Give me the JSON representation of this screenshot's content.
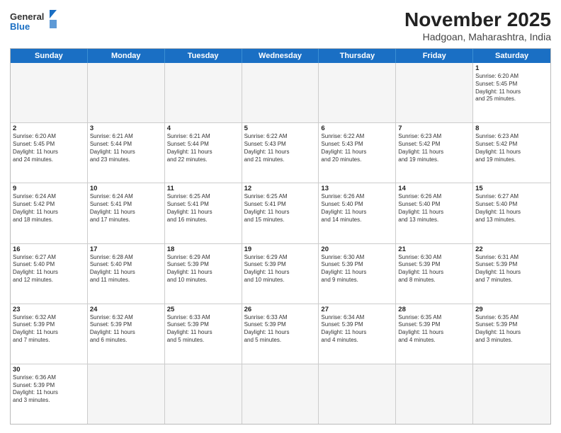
{
  "header": {
    "logo_line1": "General",
    "logo_line2": "Blue",
    "month": "November 2025",
    "location": "Hadgoan, Maharashtra, India"
  },
  "weekdays": [
    "Sunday",
    "Monday",
    "Tuesday",
    "Wednesday",
    "Thursday",
    "Friday",
    "Saturday"
  ],
  "rows": [
    [
      {
        "day": "",
        "info": "",
        "empty": true
      },
      {
        "day": "",
        "info": "",
        "empty": true
      },
      {
        "day": "",
        "info": "",
        "empty": true
      },
      {
        "day": "",
        "info": "",
        "empty": true
      },
      {
        "day": "",
        "info": "",
        "empty": true
      },
      {
        "day": "",
        "info": "",
        "empty": true
      },
      {
        "day": "1",
        "info": "Sunrise: 6:20 AM\nSunset: 5:45 PM\nDaylight: 11 hours\nand 25 minutes."
      }
    ],
    [
      {
        "day": "2",
        "info": "Sunrise: 6:20 AM\nSunset: 5:45 PM\nDaylight: 11 hours\nand 24 minutes."
      },
      {
        "day": "3",
        "info": "Sunrise: 6:21 AM\nSunset: 5:44 PM\nDaylight: 11 hours\nand 23 minutes."
      },
      {
        "day": "4",
        "info": "Sunrise: 6:21 AM\nSunset: 5:44 PM\nDaylight: 11 hours\nand 22 minutes."
      },
      {
        "day": "5",
        "info": "Sunrise: 6:22 AM\nSunset: 5:43 PM\nDaylight: 11 hours\nand 21 minutes."
      },
      {
        "day": "6",
        "info": "Sunrise: 6:22 AM\nSunset: 5:43 PM\nDaylight: 11 hours\nand 20 minutes."
      },
      {
        "day": "7",
        "info": "Sunrise: 6:23 AM\nSunset: 5:42 PM\nDaylight: 11 hours\nand 19 minutes."
      },
      {
        "day": "8",
        "info": "Sunrise: 6:23 AM\nSunset: 5:42 PM\nDaylight: 11 hours\nand 19 minutes."
      }
    ],
    [
      {
        "day": "9",
        "info": "Sunrise: 6:24 AM\nSunset: 5:42 PM\nDaylight: 11 hours\nand 18 minutes."
      },
      {
        "day": "10",
        "info": "Sunrise: 6:24 AM\nSunset: 5:41 PM\nDaylight: 11 hours\nand 17 minutes."
      },
      {
        "day": "11",
        "info": "Sunrise: 6:25 AM\nSunset: 5:41 PM\nDaylight: 11 hours\nand 16 minutes."
      },
      {
        "day": "12",
        "info": "Sunrise: 6:25 AM\nSunset: 5:41 PM\nDaylight: 11 hours\nand 15 minutes."
      },
      {
        "day": "13",
        "info": "Sunrise: 6:26 AM\nSunset: 5:40 PM\nDaylight: 11 hours\nand 14 minutes."
      },
      {
        "day": "14",
        "info": "Sunrise: 6:26 AM\nSunset: 5:40 PM\nDaylight: 11 hours\nand 13 minutes."
      },
      {
        "day": "15",
        "info": "Sunrise: 6:27 AM\nSunset: 5:40 PM\nDaylight: 11 hours\nand 13 minutes."
      }
    ],
    [
      {
        "day": "16",
        "info": "Sunrise: 6:27 AM\nSunset: 5:40 PM\nDaylight: 11 hours\nand 12 minutes."
      },
      {
        "day": "17",
        "info": "Sunrise: 6:28 AM\nSunset: 5:40 PM\nDaylight: 11 hours\nand 11 minutes."
      },
      {
        "day": "18",
        "info": "Sunrise: 6:29 AM\nSunset: 5:39 PM\nDaylight: 11 hours\nand 10 minutes."
      },
      {
        "day": "19",
        "info": "Sunrise: 6:29 AM\nSunset: 5:39 PM\nDaylight: 11 hours\nand 10 minutes."
      },
      {
        "day": "20",
        "info": "Sunrise: 6:30 AM\nSunset: 5:39 PM\nDaylight: 11 hours\nand 9 minutes."
      },
      {
        "day": "21",
        "info": "Sunrise: 6:30 AM\nSunset: 5:39 PM\nDaylight: 11 hours\nand 8 minutes."
      },
      {
        "day": "22",
        "info": "Sunrise: 6:31 AM\nSunset: 5:39 PM\nDaylight: 11 hours\nand 7 minutes."
      }
    ],
    [
      {
        "day": "23",
        "info": "Sunrise: 6:32 AM\nSunset: 5:39 PM\nDaylight: 11 hours\nand 7 minutes."
      },
      {
        "day": "24",
        "info": "Sunrise: 6:32 AM\nSunset: 5:39 PM\nDaylight: 11 hours\nand 6 minutes."
      },
      {
        "day": "25",
        "info": "Sunrise: 6:33 AM\nSunset: 5:39 PM\nDaylight: 11 hours\nand 5 minutes."
      },
      {
        "day": "26",
        "info": "Sunrise: 6:33 AM\nSunset: 5:39 PM\nDaylight: 11 hours\nand 5 minutes."
      },
      {
        "day": "27",
        "info": "Sunrise: 6:34 AM\nSunset: 5:39 PM\nDaylight: 11 hours\nand 4 minutes."
      },
      {
        "day": "28",
        "info": "Sunrise: 6:35 AM\nSunset: 5:39 PM\nDaylight: 11 hours\nand 4 minutes."
      },
      {
        "day": "29",
        "info": "Sunrise: 6:35 AM\nSunset: 5:39 PM\nDaylight: 11 hours\nand 3 minutes."
      }
    ],
    [
      {
        "day": "30",
        "info": "Sunrise: 6:36 AM\nSunset: 5:39 PM\nDaylight: 11 hours\nand 3 minutes."
      },
      {
        "day": "",
        "info": "",
        "empty": true
      },
      {
        "day": "",
        "info": "",
        "empty": true
      },
      {
        "day": "",
        "info": "",
        "empty": true
      },
      {
        "day": "",
        "info": "",
        "empty": true
      },
      {
        "day": "",
        "info": "",
        "empty": true
      },
      {
        "day": "",
        "info": "",
        "empty": true
      }
    ]
  ]
}
